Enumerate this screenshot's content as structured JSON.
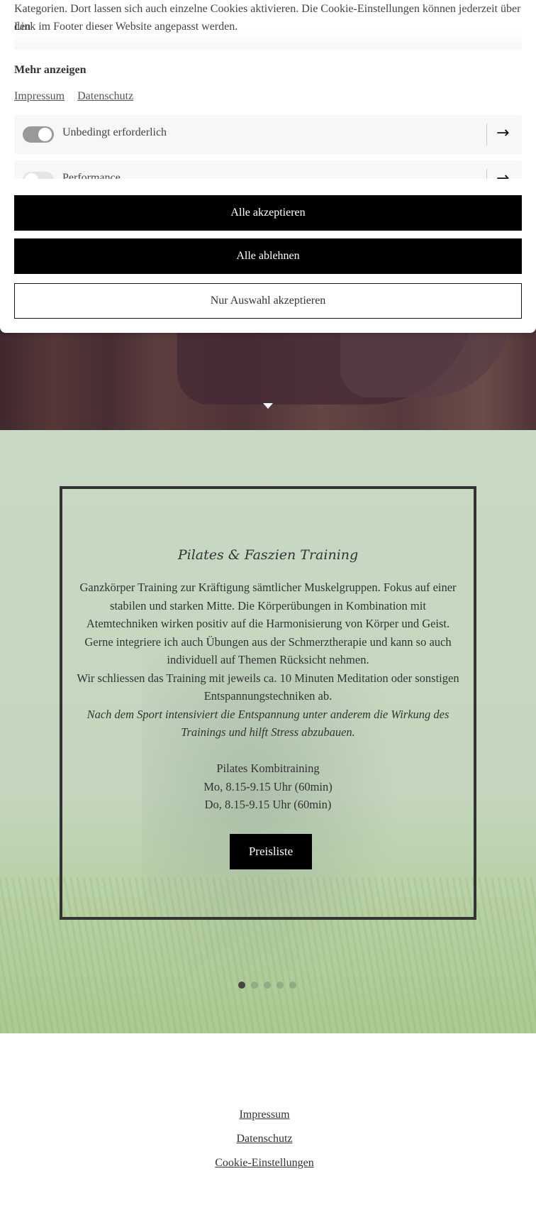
{
  "cookie_banner": {
    "text_line1": "Kategorien. Dort lassen sich auch einzelne Cookies aktivieren. Die Cookie-Einstellungen können jederzeit über den",
    "text_line2": "Link im Footer dieser Website angepasst werden.",
    "more_label": "Mehr anzeigen",
    "links": [
      "Impressum",
      "Datenschutz"
    ],
    "categories": [
      {
        "label": "Unbedingt erforderlich",
        "enabled": true
      },
      {
        "label": "Performance",
        "enabled": false
      }
    ],
    "accept_all": "Alle akzeptieren",
    "reject_all": "Alle ablehnen",
    "accept_selection": "Nur Auswahl akzeptieren"
  },
  "slide": {
    "title": "Pilates & Faszien Training",
    "paragraph1": "Ganzkörper Training zur Kräftigung sämtlicher Muskelgruppen. Fokus auf einer stabilen und starken Mitte. Die Körperübungen in Kombination mit Atemtechniken wirken positiv auf die Harmonisierung von Körper und Geist. Gerne integriere ich auch Übungen aus der Schmerztherapie und kann so auch individuell auf Themen Rücksicht nehmen.",
    "paragraph2": "Wir schliessen das Training mit jeweils ca. 10 Minuten Meditation oder sonstigen Entspannungstechniken ab.",
    "paragraph3": "Nach dem Sport intensiviert die Entspannung unter anderem die Wirkung des Trainings und hilft Stress abzubauen.",
    "course": "Pilates Kombitraining",
    "schedule": [
      "Mo, 8.15-9.15 Uhr (60min)",
      "Do, 8.15-9.15 Uhr (60min)"
    ],
    "button": "Preisliste",
    "slide_count": 5,
    "active_slide": 1
  },
  "footer": {
    "links": [
      "Impressum",
      "Datenschutz",
      "Cookie-Einstellungen"
    ]
  }
}
